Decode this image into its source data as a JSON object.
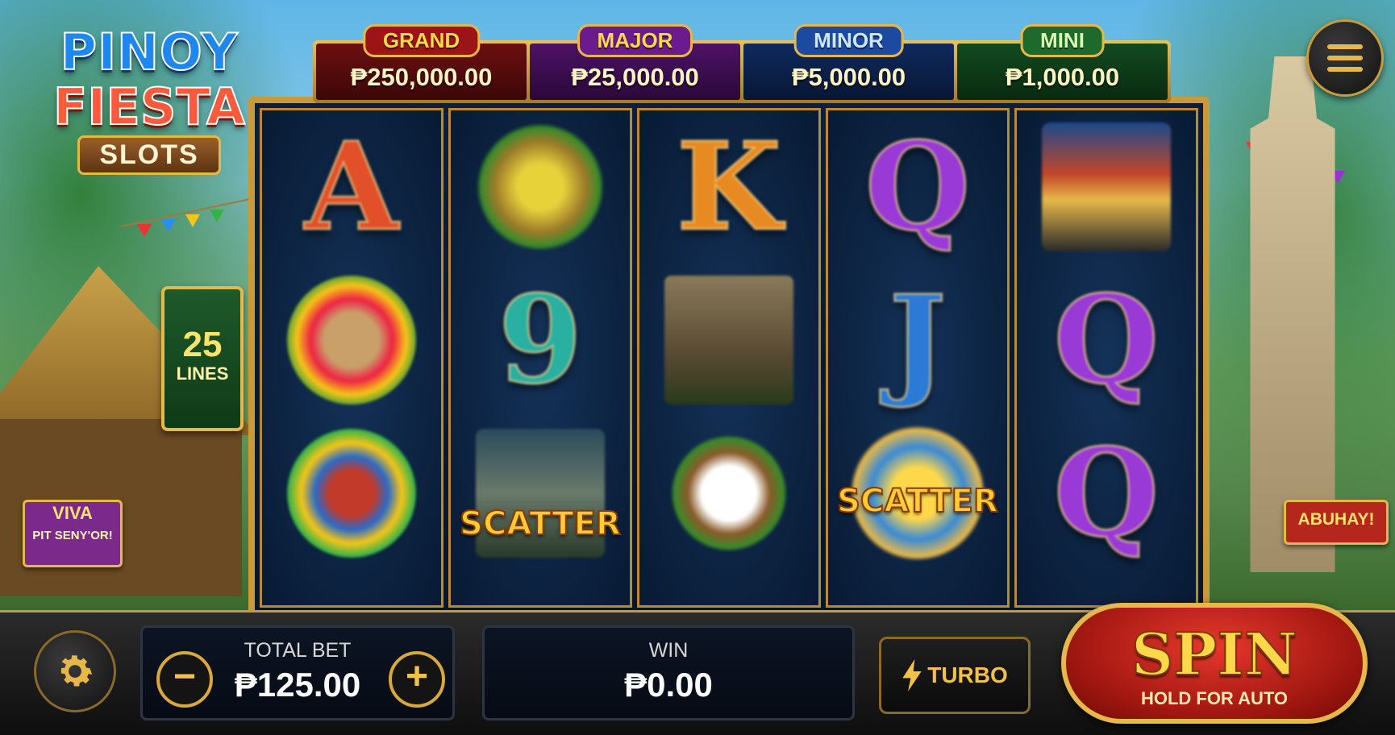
{
  "logo": {
    "line1": "PINOY",
    "line2": "FIESTA",
    "line3": "SLOTS"
  },
  "jackpots": [
    {
      "label": "GRAND",
      "value": "₱250,000.00"
    },
    {
      "label": "MAJOR",
      "value": "₱25,000.00"
    },
    {
      "label": "MINOR",
      "value": "₱5,000.00"
    },
    {
      "label": "MINI",
      "value": "₱1,000.00"
    }
  ],
  "lines": {
    "count": "25",
    "label": "LINES"
  },
  "signs": {
    "left_line1": "VIVA",
    "left_line2": "PIT SENY'OR!",
    "right": "ABUHAY!"
  },
  "reels": {
    "reel1": [
      "A",
      "mask",
      "jeepney-mask"
    ],
    "reel2": [
      "fruit-basket",
      "9",
      "church-scatter"
    ],
    "reel3": [
      "K",
      "church",
      "coconut-drink"
    ],
    "reel4": [
      "Q",
      "J",
      "sun-scatter"
    ],
    "reel5": [
      "jeepney",
      "Q",
      "Q"
    ],
    "scatter_label": "SCATTER"
  },
  "bottom": {
    "total_bet_label": "TOTAL BET",
    "total_bet_value": "₱125.00",
    "minus": "−",
    "plus": "+",
    "win_label": "WIN",
    "win_value": "₱0.00",
    "turbo_label": "TURBO",
    "spin_label": "SPIN",
    "spin_sub": "HOLD FOR AUTO"
  },
  "icons": {
    "menu": "hamburger-icon",
    "settings": "gear-icon",
    "turbo": "lightning-icon"
  },
  "colors": {
    "gold": "#e6b84a",
    "grand": "#9c1416",
    "major": "#6b1b8e",
    "minor": "#1c4aa0",
    "mini": "#1d6a2c",
    "spin": "#d32a1f"
  }
}
